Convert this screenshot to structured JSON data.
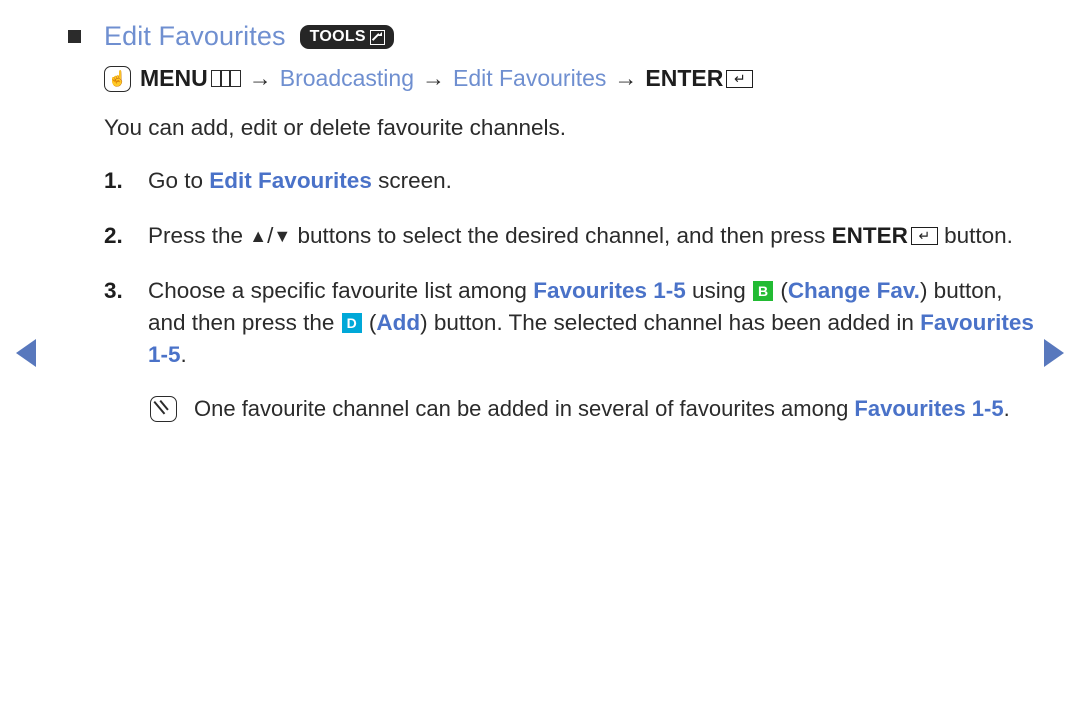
{
  "heading": {
    "title": "Edit Favourites",
    "tools_badge_label": "TOOLS",
    "tools_icon": "popup-arrow-icon",
    "bullet": "square-bullet"
  },
  "menu_path": {
    "menu_icon": "hand-press-icon",
    "menu_label": "MENU",
    "menu_bars_icon": "menu-bars-icon",
    "sep1": "→",
    "item1": "Broadcasting",
    "sep2": "→",
    "item2": "Edit Favourites",
    "sep3": "→",
    "enter_label": "ENTER",
    "enter_icon": "enter-return-icon",
    "enter_glyph": "↵"
  },
  "description": "You can add, edit or delete favourite channels.",
  "steps": [
    {
      "number": "1.",
      "parts": [
        {
          "type": "text",
          "value": "Go to "
        },
        {
          "type": "blue-bold",
          "value": "Edit Favourites"
        },
        {
          "type": "text",
          "value": " screen."
        }
      ]
    },
    {
      "number": "2.",
      "parts": [
        {
          "type": "text",
          "value": "Press the "
        },
        {
          "type": "glyph",
          "value": "▲"
        },
        {
          "type": "text",
          "value": "/"
        },
        {
          "type": "glyph",
          "value": "▼"
        },
        {
          "type": "text",
          "value": " buttons to select the desired channel, and then press "
        },
        {
          "type": "bold",
          "value": "ENTER"
        },
        {
          "type": "enter-icon",
          "value": "↵"
        },
        {
          "type": "text",
          "value": " button."
        }
      ]
    },
    {
      "number": "3.",
      "parts": [
        {
          "type": "text",
          "value": "Choose a specific favourite list among "
        },
        {
          "type": "blue-bold",
          "value": "Favourites 1-5"
        },
        {
          "type": "text",
          "value": " using "
        },
        {
          "type": "badge-b",
          "value": "B"
        },
        {
          "type": "text",
          "value": " ("
        },
        {
          "type": "blue-bold",
          "value": "Change Fav."
        },
        {
          "type": "text",
          "value": ") button, and then press the "
        },
        {
          "type": "badge-d",
          "value": "D"
        },
        {
          "type": "text",
          "value": " ("
        },
        {
          "type": "blue-bold",
          "value": "Add"
        },
        {
          "type": "text",
          "value": ") button. The selected channel has been added in "
        },
        {
          "type": "blue-bold",
          "value": "Favourites 1-5"
        },
        {
          "type": "text",
          "value": "."
        }
      ]
    }
  ],
  "note": {
    "icon": "note-pen-icon",
    "parts": [
      {
        "type": "text",
        "value": "One favourite channel can be added in several of favourites among "
      },
      {
        "type": "blue-bold",
        "value": "Favourites 1-5"
      },
      {
        "type": "text",
        "value": "."
      }
    ]
  },
  "navigation": {
    "prev_icon": "triangle-left-icon",
    "next_icon": "triangle-right-icon",
    "accent": "#5878bd"
  },
  "colors": {
    "title_blue": "#6f8fd0",
    "keyword_blue": "#4a72c8",
    "badge_b_green": "#22bb33",
    "badge_d_cyan": "#00a8d8",
    "text": "#2b2b2b"
  }
}
